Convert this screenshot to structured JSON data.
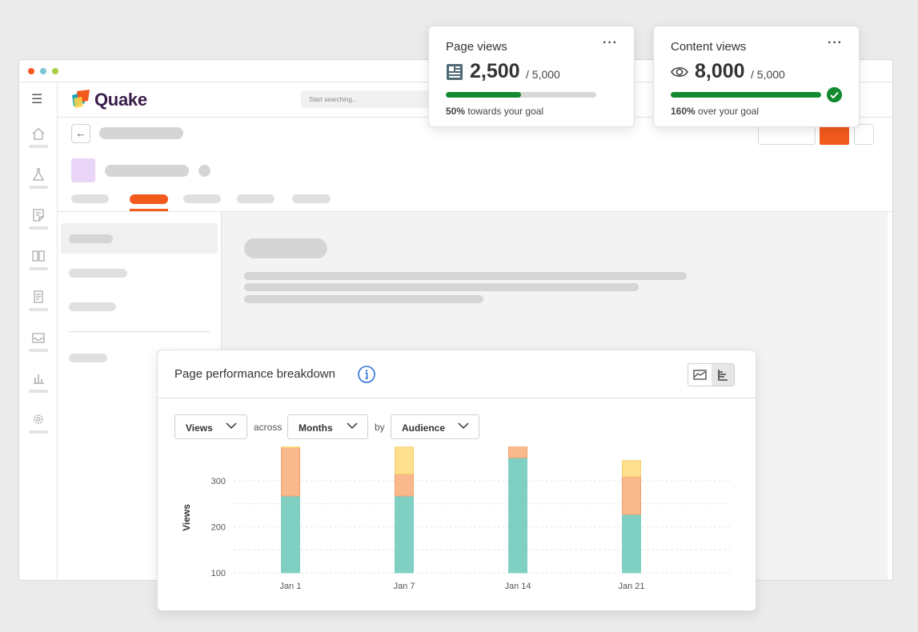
{
  "app": {
    "name": "Quake"
  },
  "header": {
    "search_placeholder": "Start searching..."
  },
  "cards": {
    "page_views": {
      "title": "Page views",
      "value": "2,500",
      "goal": "/ 5,000",
      "progress": 0.5,
      "note_bold": "50%",
      "note_rest": " towards your goal",
      "icon": "newspaper-icon"
    },
    "content_views": {
      "title": "Content views",
      "value": "8,000",
      "goal": "/ 5,000",
      "progress": 1.0,
      "note_bold": "160%",
      "note_rest": " over your goal",
      "icon": "eye-icon"
    }
  },
  "chart_panel": {
    "title": "Page performance breakdown",
    "filters": {
      "metric": "Views",
      "across_label": "across",
      "period": "Months",
      "by_label": "by",
      "group": "Audience"
    }
  },
  "colors": {
    "accent": "#f25a1d",
    "success": "#128a2f",
    "teal": "#7fd0c2",
    "orange": "#f9b98c",
    "yellow": "#fde08f"
  },
  "chart_data": {
    "type": "bar",
    "stacked": true,
    "categories": [
      "Jan 1",
      "Jan 7",
      "Jan 14",
      "Jan 21"
    ],
    "series": [
      {
        "values": [
          167,
          167,
          250,
          127
        ]
      },
      {
        "values": [
          105,
          48,
          48,
          82
        ]
      },
      {
        "values": [
          43,
          102,
          37,
          35
        ]
      }
    ],
    "ylabel": "Views",
    "yticks": [
      100,
      200,
      300
    ],
    "ylim": [
      100,
      340
    ],
    "grid": true
  }
}
